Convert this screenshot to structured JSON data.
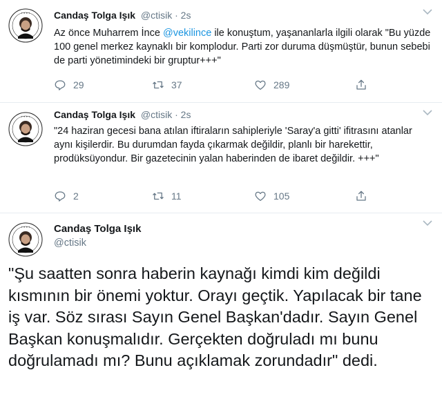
{
  "tweets": [
    {
      "author_name": "Candaş Tolga Işık",
      "handle": "@ctisik",
      "separator": "·",
      "time": "2s",
      "text_before": "Az önce Muharrem İnce ",
      "mention": "@vekilince",
      "text_after": "  ile konuştum, yaşananlarla ilgili olarak \"Bu yüzde 100 genel merkez kaynaklı bir komplodur. Parti zor duruma düşmüştür, bunun sebebi de parti yönetimindeki bir gruptur+++\"",
      "replies": "29",
      "retweets": "37",
      "likes": "289"
    },
    {
      "author_name": "Candaş Tolga Işık",
      "handle": "@ctisik",
      "separator": "·",
      "time": "2s",
      "text": "\"24 haziran gecesi bana atılan iftiraların sahipleriyle 'Saray'a gitti' ifitrasını atanlar aynı kişilerdir. Bu durumdan fayda çıkarmak değildir, planlı bir harekettir, prodüksüyondur. Bir gazetecinin yalan haberinden de ibaret değildir. +++\"",
      "replies": "2",
      "retweets": "11",
      "likes": "105"
    },
    {
      "author_name": "Candaş Tolga Işık",
      "handle": "@ctisik",
      "text": "\"Şu saatten sonra haberin kaynağı kimdi kim değildi kısmının bir önemi yoktur. Orayı geçtik. Yapılacak bir tane iş var. Söz sırası Sayın Genel Başkan'dadır. Sayın Genel Başkan konuşmalıdır. Gerçekten doğruladı mı bunu doğrulamadı mı? Bunu açıklamak zorundadır\" dedi."
    }
  ],
  "icons": {
    "avatar": "avatar-icon",
    "caret": "chevron-down-icon",
    "reply": "reply-icon",
    "retweet": "retweet-icon",
    "like": "heart-icon",
    "share": "share-icon"
  },
  "colors": {
    "text": "#14171a",
    "secondary": "#657786",
    "link": "#1b95e0",
    "divider": "#e6ecf0"
  }
}
